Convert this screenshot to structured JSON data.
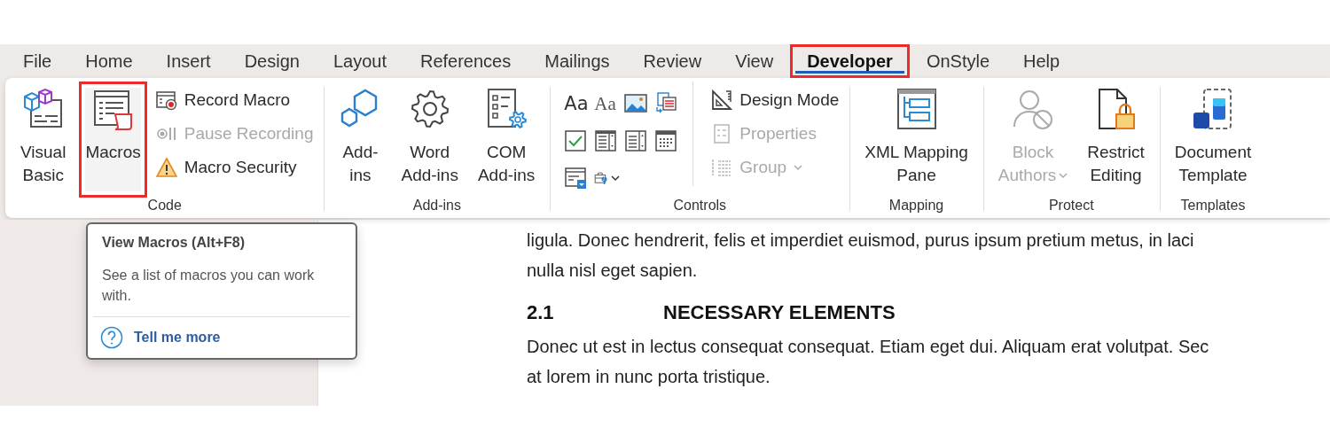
{
  "tabs": [
    {
      "label": "File",
      "selected": false,
      "highlighted": false
    },
    {
      "label": "Home",
      "selected": false,
      "highlighted": false
    },
    {
      "label": "Insert",
      "selected": false,
      "highlighted": false
    },
    {
      "label": "Design",
      "selected": false,
      "highlighted": false
    },
    {
      "label": "Layout",
      "selected": false,
      "highlighted": false
    },
    {
      "label": "References",
      "selected": false,
      "highlighted": false
    },
    {
      "label": "Mailings",
      "selected": false,
      "highlighted": false
    },
    {
      "label": "Review",
      "selected": false,
      "highlighted": false
    },
    {
      "label": "View",
      "selected": false,
      "highlighted": false
    },
    {
      "label": "Developer",
      "selected": true,
      "highlighted": true
    },
    {
      "label": "OnStyle",
      "selected": false,
      "highlighted": false
    },
    {
      "label": "Help",
      "selected": false,
      "highlighted": false
    }
  ],
  "ribbon": {
    "groups": [
      {
        "label": "Code",
        "commands": [
          {
            "kind": "large",
            "lines": [
              "Visual",
              "Basic"
            ],
            "disabled": false,
            "highlighted": false,
            "dropdown": false
          },
          {
            "kind": "large",
            "lines": [
              "Macros"
            ],
            "disabled": false,
            "highlighted": true,
            "dropdown": false
          },
          {
            "kind": "stack",
            "items": [
              {
                "label": "Record Macro",
                "disabled": false,
                "dropdown": false
              },
              {
                "label": "Pause Recording",
                "disabled": true,
                "dropdown": false
              },
              {
                "label": "Macro Security",
                "disabled": false,
                "dropdown": false
              }
            ]
          }
        ]
      },
      {
        "label": "Add-ins",
        "commands": [
          {
            "kind": "large",
            "lines": [
              "Add-",
              "ins"
            ],
            "disabled": false,
            "highlighted": false,
            "dropdown": false
          },
          {
            "kind": "large",
            "lines": [
              "Word",
              "Add-ins"
            ],
            "disabled": false,
            "highlighted": false,
            "dropdown": false
          },
          {
            "kind": "large",
            "lines": [
              "COM",
              "Add-ins"
            ],
            "disabled": false,
            "highlighted": false,
            "dropdown": false
          }
        ]
      },
      {
        "label": "Controls",
        "commands": [
          {
            "kind": "grid",
            "items": [
              {
                "kind": "glyph",
                "text": "Aa"
              },
              {
                "kind": "glyph",
                "text": "Aa"
              },
              {
                "kind": "icon",
                "dropdown": false
              },
              {
                "kind": "icon",
                "dropdown": false
              },
              {
                "kind": "icon",
                "dropdown": false
              },
              {
                "kind": "icon",
                "dropdown": false
              },
              {
                "kind": "icon",
                "dropdown": false
              },
              {
                "kind": "icon",
                "dropdown": false
              },
              {
                "kind": "icon",
                "dropdown": false
              },
              {
                "kind": "icon",
                "dropdown": true
              }
            ]
          },
          {
            "kind": "stack",
            "items": [
              {
                "label": "Design Mode",
                "disabled": false,
                "dropdown": false
              },
              {
                "label": "Properties",
                "disabled": true,
                "dropdown": false
              },
              {
                "label": "Group",
                "disabled": true,
                "dropdown": true
              }
            ]
          }
        ]
      },
      {
        "label": "Mapping",
        "commands": [
          {
            "kind": "large",
            "lines": [
              "XML Mapping",
              "Pane"
            ],
            "disabled": false,
            "highlighted": false,
            "dropdown": false
          }
        ]
      },
      {
        "label": "Protect",
        "commands": [
          {
            "kind": "large",
            "lines": [
              "Block",
              "Authors"
            ],
            "disabled": true,
            "highlighted": false,
            "dropdown": true
          },
          {
            "kind": "large",
            "lines": [
              "Restrict",
              "Editing"
            ],
            "disabled": false,
            "highlighted": false,
            "dropdown": false
          }
        ]
      },
      {
        "label": "Templates",
        "commands": [
          {
            "kind": "large",
            "lines": [
              "Document",
              "Template"
            ],
            "disabled": false,
            "highlighted": false,
            "dropdown": false
          }
        ]
      }
    ]
  },
  "tooltip": {
    "title": "View Macros (Alt+F8)",
    "description": "See a list of macros you can work with.",
    "link": "Tell me more"
  },
  "document": {
    "blocks": [
      {
        "kind": "line",
        "text": "ligula. Donec hendrerit, felis et imperdiet euismod, purus ipsum pretium metus, in laci"
      },
      {
        "kind": "line",
        "text": "nulla nisl eget sapien."
      },
      {
        "kind": "heading",
        "number": "2.1",
        "text": "NECESSARY ELEMENTS"
      },
      {
        "kind": "line",
        "text": "Donec ut est in lectus consequat consequat. Etiam eget dui. Aliquam erat volutpat. Sec"
      },
      {
        "kind": "line",
        "text": "at lorem in nunc porta tristique."
      }
    ]
  }
}
